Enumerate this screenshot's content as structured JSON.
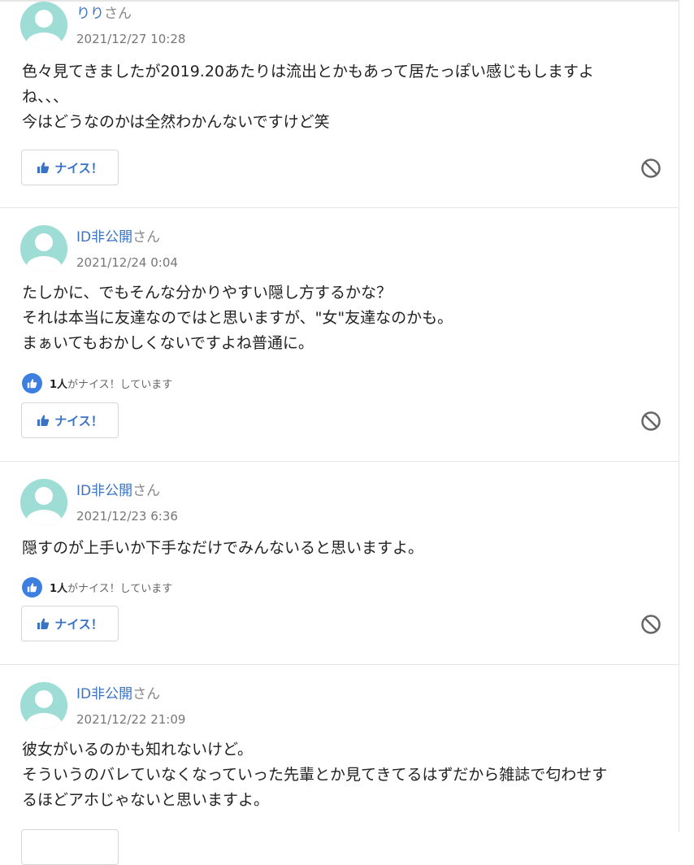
{
  "answers": [
    {
      "username": "りり",
      "honorific": "さん",
      "timestamp": "2021/12/27 10:28",
      "body": [
        "色々見てきましたが2019.20あたりは流出とかもあって居たっぽい感じもしますよ",
        "ね、、、",
        "今はどうなのかは全然わかんないですけど笑"
      ],
      "nice_label": "ナイス！"
    },
    {
      "username": "ID非公開",
      "honorific": "さん",
      "timestamp": "2021/12/24 0:04",
      "body": [
        "たしかに、でもそんな分かりやすい隠し方するかな？",
        "それは本当に友達なのではと思いますが、\"女\"友達なのかも。",
        "まぁいてもおかしくないですよね普通に。"
      ],
      "likes_count": "1人",
      "likes_text": "がナイス！しています",
      "nice_label": "ナイス！"
    },
    {
      "username": "ID非公開",
      "honorific": "さん",
      "timestamp": "2021/12/23 6:36",
      "body": [
        "隠すのが上手いか下手なだけでみんないると思いますよ。"
      ],
      "likes_count": "1人",
      "likes_text": "がナイス！しています",
      "nice_label": "ナイス！"
    },
    {
      "username": "ID非公開",
      "honorific": "さん",
      "timestamp": "2021/12/22 21:09",
      "body": [
        "彼女がいるのかも知れないけど。",
        "そういうのバレていなくなっていった先輩とか見てきてるはずだから雑誌で匂わせす",
        "るほどアホじゃないと思いますよ。"
      ]
    }
  ],
  "icons": {
    "avatar": "default-user-avatar",
    "thumbs_up": "thumbs-up-icon",
    "report": "prohibited-icon"
  },
  "colors": {
    "username": "#3a73c4",
    "accent": "#3c7fe0",
    "avatar_bg": "#9edcd6"
  }
}
